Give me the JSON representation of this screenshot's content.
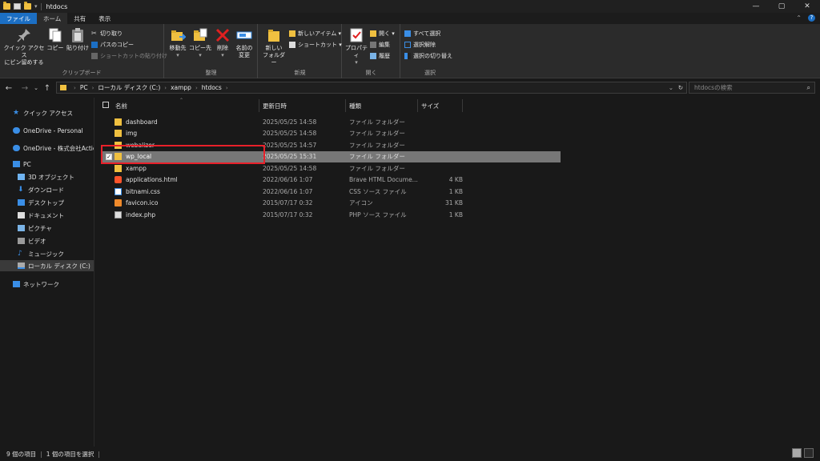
{
  "window": {
    "title": "htdocs",
    "controls": [
      "—",
      "▢",
      "✕"
    ]
  },
  "ribbon_tabs": [
    "ファイル",
    "ホーム",
    "共有",
    "表示"
  ],
  "ribbon": {
    "clipboard": {
      "label": "クリップボード",
      "pin_label": "クイック アクセス\nにピン留めする",
      "copy_label": "コピー",
      "paste_label": "貼り付け",
      "cut_label": "切り取り",
      "copy_path_label": "パスのコピー",
      "paste_shortcut_label": "ショートカットの貼り付け"
    },
    "organize": {
      "label": "整理",
      "move_label": "移動先",
      "copyto_label": "コピー先",
      "delete_label": "削除",
      "rename_label": "名前の\n変更"
    },
    "new": {
      "label": "新規",
      "newfolder_label": "新しい\nフォルダー",
      "newitem_label": "新しいアイテム ▾",
      "shortcut_label": "ショートカット ▾"
    },
    "open": {
      "label": "開く",
      "properties_label": "プロパティ",
      "open_label": "開く ▾",
      "edit_label": "編集",
      "history_label": "履歴"
    },
    "select": {
      "label": "選択",
      "selectall_label": "すべて選択",
      "selectnone_label": "選択解除",
      "invert_label": "選択の切り替え"
    }
  },
  "address": {
    "crumbs": [
      "PC",
      "ローカル ディスク (C:)",
      "xampp",
      "htdocs"
    ],
    "search_placeholder": "htdocsの検索"
  },
  "nav": {
    "quick_access": "クイック アクセス",
    "onedrive_personal": "OneDrive - Personal",
    "onedrive_corp": "OneDrive - 株式会社Actic",
    "pc": "PC",
    "objects3d": "3D オブジェクト",
    "downloads": "ダウンロード",
    "desktop": "デスクトップ",
    "documents": "ドキュメント",
    "pictures": "ピクチャ",
    "videos": "ビデオ",
    "music": "ミュージック",
    "localdisk": "ローカル ディスク (C:)",
    "network": "ネットワーク"
  },
  "columns": {
    "name": "名前",
    "date": "更新日時",
    "type": "種類",
    "size": "サイズ"
  },
  "files": [
    {
      "name": "dashboard",
      "date": "2025/05/25 14:58",
      "type": "ファイル フォルダー",
      "size": "",
      "icon": "folder-icon"
    },
    {
      "name": "img",
      "date": "2025/05/25 14:58",
      "type": "ファイル フォルダー",
      "size": "",
      "icon": "folder-icon"
    },
    {
      "name": "webalizer",
      "date": "2025/05/25 14:57",
      "type": "ファイル フォルダー",
      "size": "",
      "icon": "folder-icon"
    },
    {
      "name": "wp_local",
      "date": "2025/05/25 15:31",
      "type": "ファイル フォルダー",
      "size": "",
      "icon": "folder-icon"
    },
    {
      "name": "xampp",
      "date": "2025/05/25 14:58",
      "type": "ファイル フォルダー",
      "size": "",
      "icon": "folder-icon"
    },
    {
      "name": "applications.html",
      "date": "2022/06/16 1:07",
      "type": "Brave HTML Docume...",
      "size": "4 KB",
      "icon": "brave-html-icon"
    },
    {
      "name": "bitnami.css",
      "date": "2022/06/16 1:07",
      "type": "CSS ソース ファイル",
      "size": "1 KB",
      "icon": "css-file-icon"
    },
    {
      "name": "favicon.ico",
      "date": "2015/07/17 0:32",
      "type": "アイコン",
      "size": "31 KB",
      "icon": "ico-file-icon"
    },
    {
      "name": "index.php",
      "date": "2015/07/17 0:32",
      "type": "PHP ソース ファイル",
      "size": "1 KB",
      "icon": "php-file-icon"
    }
  ],
  "status": {
    "count": "9 個の項目",
    "selected": "1 個の項目を選択"
  },
  "colors": {
    "accent": "#1c6fc4",
    "highlight": "#e8202a",
    "folder": "#f0c040"
  }
}
